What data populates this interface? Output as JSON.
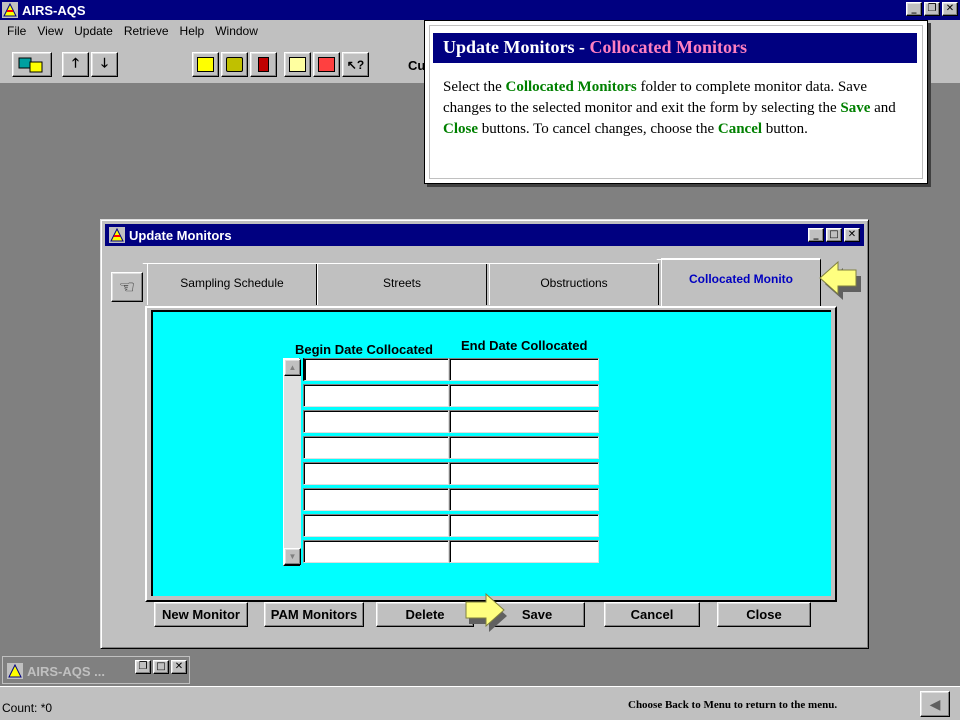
{
  "app": {
    "title": "AIRS-AQS",
    "trailing_label": "Cu"
  },
  "menu": [
    "File",
    "View",
    "Update",
    "Retrieve",
    "Help",
    "Window"
  ],
  "callout": {
    "title": "Update Monitors - ",
    "title_sub": "Collocated Monitors",
    "p1": "Select the ",
    "k1": "Collocated Monitors",
    "p2": " folder to complete monitor data.  Save changes to the selected monitor and exit the form by selecting the ",
    "k2": "Save",
    "p3": " and ",
    "k3": "Close",
    "p4": " buttons.  To cancel changes, choose the ",
    "k4": "Cancel",
    "p5": " button."
  },
  "window": {
    "title": "Update Monitors",
    "tabs": [
      "Sampling Schedule",
      "Streets",
      "Obstructions",
      "Collocated Monito"
    ],
    "active_tab": "Collocated Monito",
    "columns": [
      "Begin Date Collocated",
      "End Date Collocated"
    ],
    "rows": [
      [
        "",
        ""
      ],
      [
        "",
        ""
      ],
      [
        "",
        ""
      ],
      [
        "",
        ""
      ],
      [
        "",
        ""
      ],
      [
        "",
        ""
      ],
      [
        "",
        ""
      ],
      [
        "",
        ""
      ]
    ],
    "buttons": {
      "new": "New Monitor",
      "pam": "PAM Monitors",
      "delete": "Delete",
      "save": "Save",
      "cancel": "Cancel",
      "close": "Close"
    }
  },
  "minimized": {
    "title": "AIRS-AQS ..."
  },
  "status": {
    "count": "Count: *0",
    "hint": "Choose Back to Menu to return to the menu."
  },
  "colors": {
    "titlebar": "#000080",
    "client_bg": "#00ffff",
    "keyword": "#008000",
    "callout_sub": "#ff80c0",
    "active_tab_text": "#0000c0",
    "arrow_fill": "#ffff80"
  }
}
